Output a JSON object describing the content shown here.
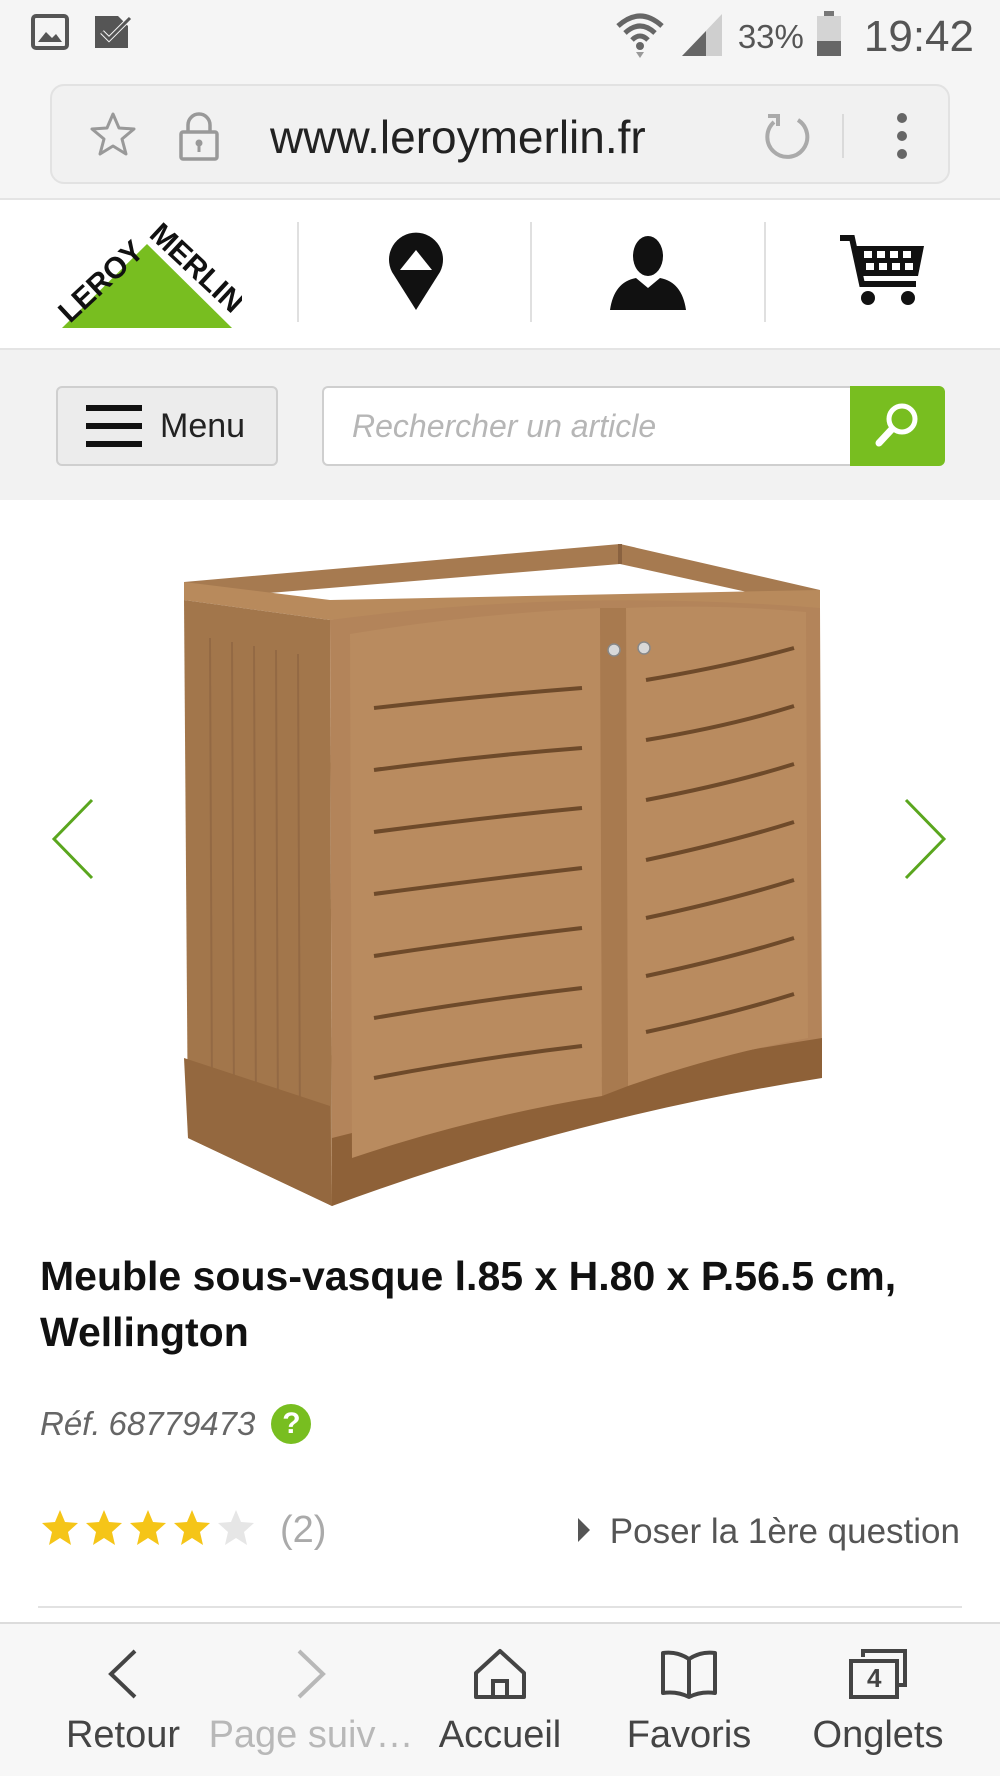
{
  "status_bar": {
    "battery_percent": "33%",
    "time": "19:42",
    "icons": [
      "gallery-icon",
      "check-notification-icon",
      "wifi-icon",
      "signal-icon",
      "battery-icon"
    ]
  },
  "browser": {
    "url": "www.leroymerlin.fr",
    "icons": [
      "star-icon",
      "lock-icon",
      "reload-icon",
      "overflow-menu-icon"
    ]
  },
  "site_header": {
    "logo_text": "LEROY MERLIN",
    "icons": [
      "store-locator-icon",
      "account-icon",
      "cart-icon"
    ]
  },
  "search": {
    "menu_label": "Menu",
    "placeholder": "Rechercher un article",
    "value": ""
  },
  "product": {
    "title": "Meuble sous-vasque l.85 x H.80 x P.56.5 cm, Wellington",
    "ref_prefix": "Réf.",
    "ref_number": "68779473",
    "help_badge": "?",
    "rating": 4,
    "rating_max": 5,
    "review_count": "(2)",
    "question_link": "Poser la 1ère question"
  },
  "colors": {
    "brand_green": "#78be20",
    "star_gold": "#f5c518",
    "star_empty": "#e6e6e6"
  },
  "toolbar": {
    "back": "Retour",
    "forward": "Page suiv…",
    "home": "Accueil",
    "bookmarks": "Favoris",
    "tabs": "Onglets",
    "tab_count": "4"
  }
}
